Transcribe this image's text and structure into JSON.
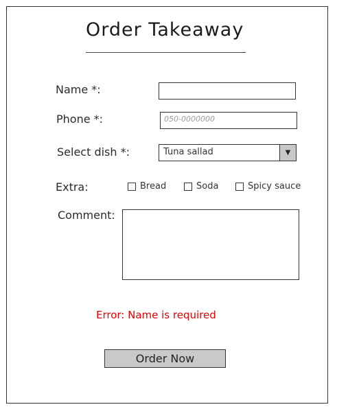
{
  "form": {
    "title": "Order Takeaway",
    "name_label": "Name *:",
    "name_value": "",
    "phone_label": "Phone *:",
    "phone_placeholder": "050-0000000",
    "dish_label": "Select dish *:",
    "dish_selected": "Tuna sallad",
    "dish_arrow": "▼",
    "extra_label": "Extra:",
    "extras": [
      {
        "label": "Bread",
        "checked": false
      },
      {
        "label": "Soda",
        "checked": false
      },
      {
        "label": "Spicy sauce",
        "checked": false
      }
    ],
    "comment_label": "Comment:",
    "comment_value": "",
    "error_text": "Error: Name is required",
    "submit_label": "Order Now"
  },
  "colors": {
    "error": "#e60000",
    "button_bg": "#c9c9c9",
    "border": "#333333"
  }
}
